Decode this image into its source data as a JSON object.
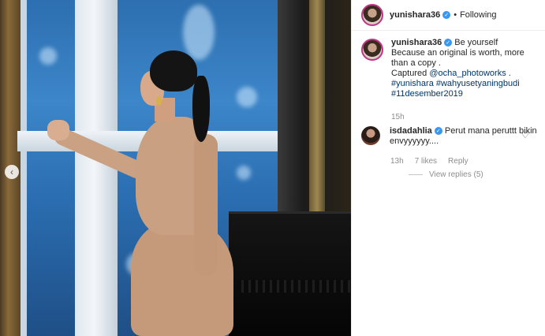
{
  "post": {
    "author": {
      "username": "yunishara36",
      "verified": true,
      "follow_separator": "•",
      "follow_state": "Following"
    },
    "caption": {
      "username": "yunishara36",
      "lines": [
        "Be yourself",
        "Because an original is worth, more",
        "than a copy .",
        "Captured ",
        "@ocha_photoworks",
        " .",
        "#yunishara #wahyusetyaningbudi",
        "#11desember2019"
      ],
      "time": "15h"
    },
    "comments": [
      {
        "username": "isdadahlia",
        "verified": true,
        "text": "Perut mana peruttt bikin envyyyyyy....",
        "time": "13h",
        "likes": "7 likes",
        "reply_label": "Reply",
        "view_replies": "View replies (5)"
      }
    ],
    "icons": {
      "carousel_prev": "chevron-left-icon",
      "like": "heart-outline-icon",
      "verified": "verified-badge-icon"
    },
    "colors": {
      "verified_blue": "#3897f0",
      "link": "#003569",
      "muted": "#8e8e8e",
      "story_ring": "#c13584"
    }
  }
}
